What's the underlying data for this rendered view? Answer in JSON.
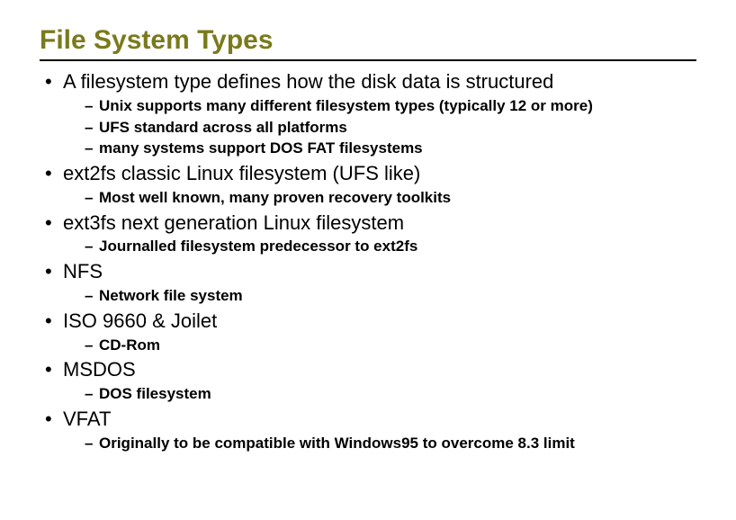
{
  "title": "File System Types",
  "items": [
    {
      "text": "A filesystem type defines how the disk data is structured",
      "sub": [
        "Unix supports many different filesystem types (typically 12 or more)",
        "UFS standard across all platforms",
        "many systems support DOS FAT filesystems"
      ]
    },
    {
      "text": "ext2fs classic Linux filesystem (UFS like)",
      "sub": [
        "Most well known, many proven recovery  toolkits"
      ]
    },
    {
      "text": "ext3fs next generation Linux filesystem",
      "sub": [
        "Journalled filesystem predecessor to ext2fs"
      ]
    },
    {
      "text": "NFS",
      "sub": [
        "Network file system"
      ]
    },
    {
      "text": "ISO 9660 & Joilet",
      "sub": [
        "CD-Rom"
      ]
    },
    {
      "text": "MSDOS",
      "sub": [
        "DOS filesystem"
      ]
    },
    {
      "text": "VFAT",
      "sub": [
        "Originally to be compatible with Windows95 to overcome 8.3 limit"
      ]
    }
  ]
}
